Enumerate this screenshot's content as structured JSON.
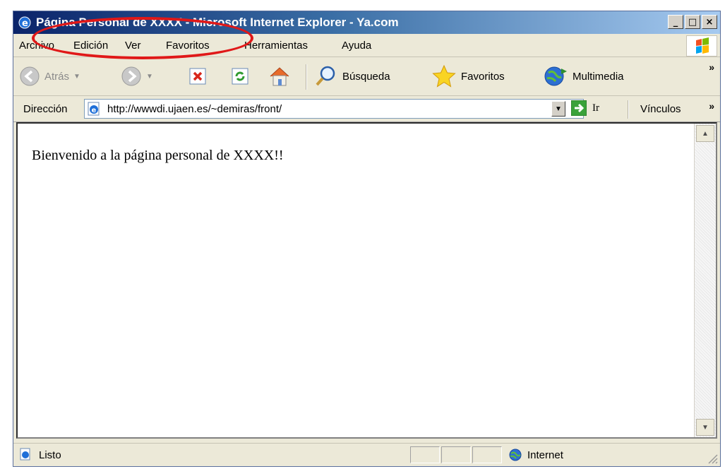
{
  "window": {
    "title": "Página Personal de XXXX - Microsoft Internet Explorer - Ya.com",
    "buttons": {
      "minimize": "_",
      "maximize": "□",
      "close": "×"
    }
  },
  "menu": [
    "Archivo",
    "Edición",
    "Ver",
    "Favoritos",
    "Herramientas",
    "Ayuda"
  ],
  "toolbar": {
    "back_label": "Atrás",
    "search_label": "Búsqueda",
    "favorites_label": "Favoritos",
    "media_label": "Multimedia",
    "more": "»"
  },
  "address": {
    "label": "Dirección",
    "url": "http://wwwdi.ujaen.es/~demiras/front/",
    "go_label": "Ir",
    "links_label": "Vínculos",
    "links_more": "»"
  },
  "page": {
    "text": "Bienvenido a la página personal de XXXX!!"
  },
  "status": {
    "text": "Listo",
    "zone": "Internet"
  },
  "colors": {
    "titlebar_start": "#0a246a",
    "titlebar_end": "#a6caf0",
    "highlight": "#e01818",
    "chrome": "#ece9d8"
  },
  "icons": [
    "ie-icon",
    "back-icon",
    "forward-icon",
    "stop-icon",
    "refresh-icon",
    "home-icon",
    "search-icon",
    "favorites-star-icon",
    "media-icon",
    "windows-logo-icon",
    "go-arrow-icon",
    "page-icon",
    "globe-icon",
    "resize-grip-icon"
  ]
}
